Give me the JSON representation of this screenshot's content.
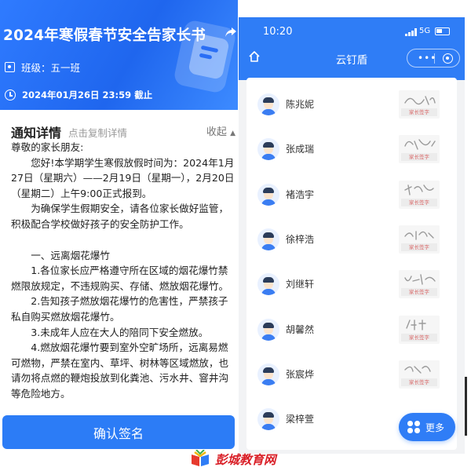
{
  "left": {
    "title": "2024年寒假春节安全告家长书",
    "class_label": "班级：五一班",
    "deadline": "2024年01月26日 23:59 截止",
    "card_title": "通知详情",
    "card_hint": "点击复制详情",
    "collapse_label": "收起",
    "paragraphs": [
      "尊敬的家长朋友:",
      "您好!本学期学生寒假放假时间为：2024年1月27日（星期六）——2月19日（星期一），2月20日（星期二）上午9:00正式报到。",
      "为确保学生假期安全，请各位家长做好监管，积极配合学校做好孩子的安全防护工作。",
      "",
      "一、远离烟花爆竹",
      "1.各位家长应严格遵守所在区域的烟花爆竹禁燃限放规定，不违规购买、存储、燃放烟花爆竹。",
      "2.告知孩子燃放烟花爆竹的危害性，严禁孩子私自购买燃放烟花爆竹。",
      "3.未成年人应在大人的陪同下安全燃放。",
      "4.燃放烟花爆竹要到室外空旷场所，远离易燃可燃物，严禁在室内、草坪、树林等区域燃放，也请勿将点燃的鞭炮投放到化粪池、污水井、窨井沟等危险地方。"
    ],
    "confirm_button": "确认签名"
  },
  "right": {
    "status_time": "10:20",
    "network": "5G",
    "app_title": "云钉盾",
    "capsule_dots": "•••",
    "signature_tag": "家长签字",
    "students": [
      "陈兆妮",
      "张成瑞",
      "褚浩宇",
      "徐梓浩",
      "刘继轩",
      "胡馨然",
      "张宸烨",
      "梁梓萱"
    ],
    "more_button": "更多"
  },
  "footer": {
    "site_name": "彭城教育网"
  },
  "colors": {
    "brand_blue": "#2f7df6",
    "header_blue": "#1f66ee",
    "logo_red": "#d91e26"
  },
  "icons": [
    "share-icon",
    "class-icon",
    "clock-icon",
    "home-icon",
    "more-dots-icon",
    "record-icon",
    "grid-icon",
    "avatar-icon"
  ]
}
